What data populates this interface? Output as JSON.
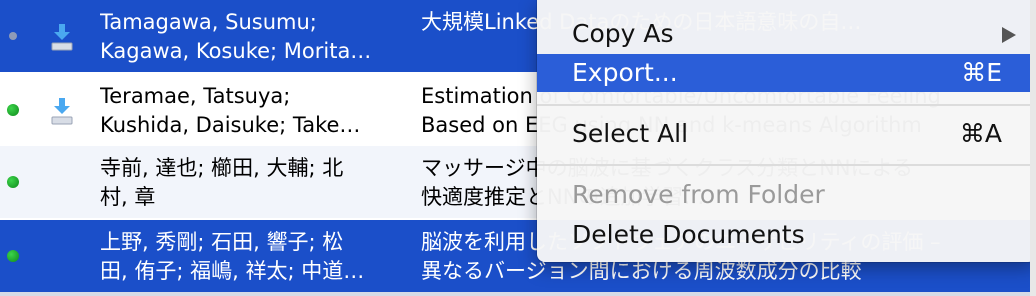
{
  "rows": [
    {
      "status": "grey",
      "download": true,
      "authors": [
        "Tamagawa, Susumu;",
        "Kagawa, Kosuke; Morita…"
      ],
      "title": [
        "大規模Linked Dataのための日本語意味の自…",
        ""
      ]
    },
    {
      "status": "green",
      "download": true,
      "authors": [
        "Teramae, Tatsuya;",
        "Kushida, Daisuke; Take…"
      ],
      "title": [
        "Estimation of Comfortable/Uncomfortable Feeling",
        "Based on EEG using NN and k-means Algorithm"
      ]
    },
    {
      "status": "green",
      "download": false,
      "authors": [
        "寺前, 達也; 櫛田, 大輔; 北",
        "村, 章"
      ],
      "title": [
        "マッサージ中の脳波に基づくクラス分類とNNによる",
        "快適度推定とNNの追加学習…"
      ]
    },
    {
      "status": "green",
      "download": false,
      "authors": [
        "上野, 秀剛; 石田, 響子; 松",
        "田, 侑子; 福嶋, 祥太; 中道…"
      ],
      "title": [
        "脳波を利用したソフトウェアのユーザビリティの評価 –",
        "異なるバージョン間における周波数成分の比較"
      ]
    }
  ],
  "context_menu": {
    "items": [
      {
        "label": "Copy As",
        "shortcut": "",
        "submenu": true,
        "state": "normal"
      },
      {
        "label": "Export...",
        "shortcut": "⌘E",
        "submenu": false,
        "state": "highlighted"
      },
      {
        "label": "Select All",
        "shortcut": "⌘A",
        "submenu": false,
        "state": "normal"
      },
      {
        "label": "Remove from Folder",
        "shortcut": "",
        "submenu": false,
        "state": "disabled"
      },
      {
        "label": "Delete Documents",
        "shortcut": "",
        "submenu": false,
        "state": "normal"
      }
    ]
  },
  "colors": {
    "selection": "#1b4fc9",
    "menu_highlight": "#2b5ed8",
    "status_green": "#1aa52a",
    "status_grey": "#8e9bb8"
  }
}
